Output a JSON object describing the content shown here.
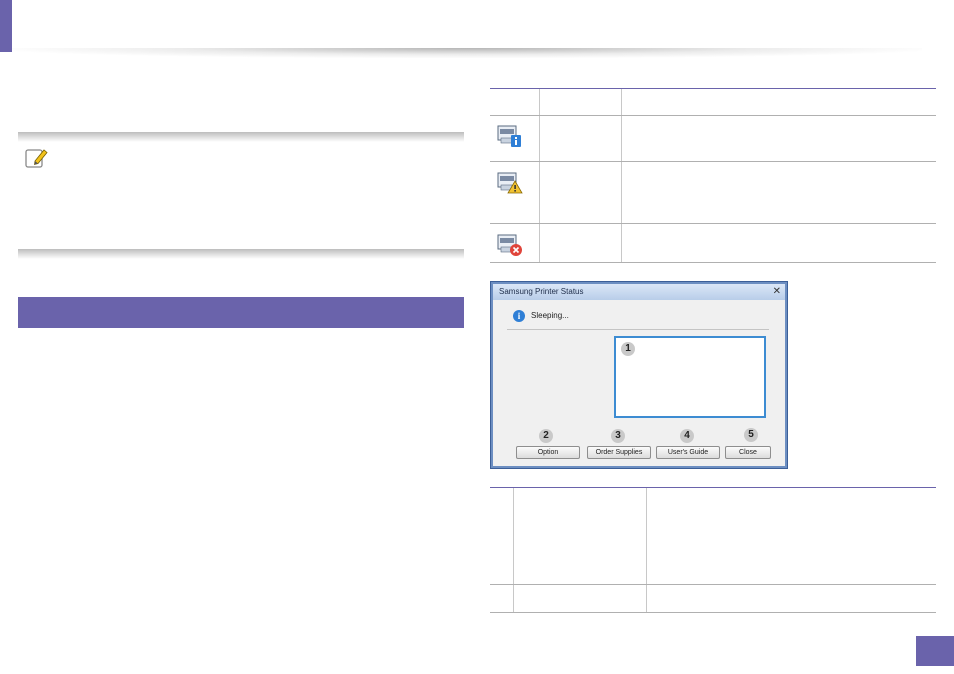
{
  "dialog": {
    "title": "Samsung Printer Status",
    "close_glyph": "✕",
    "status_text": "Sleeping...",
    "info_glyph": "i",
    "callouts": [
      "1",
      "2",
      "3",
      "4",
      "5"
    ],
    "buttons": {
      "option": "Option",
      "order_supplies": "Order Supplies",
      "users_guide": "User's Guide",
      "close": "Close"
    }
  },
  "icons": {
    "note": "note-pencil-icon",
    "status_normal": "printer-info-icon",
    "status_warning": "printer-warning-icon",
    "status_error": "printer-error-icon"
  },
  "colors": {
    "accent": "#6a63ab",
    "info_blue": "#2f7fd6",
    "warning_yellow": "#f1c232",
    "error_red": "#e0443a"
  }
}
